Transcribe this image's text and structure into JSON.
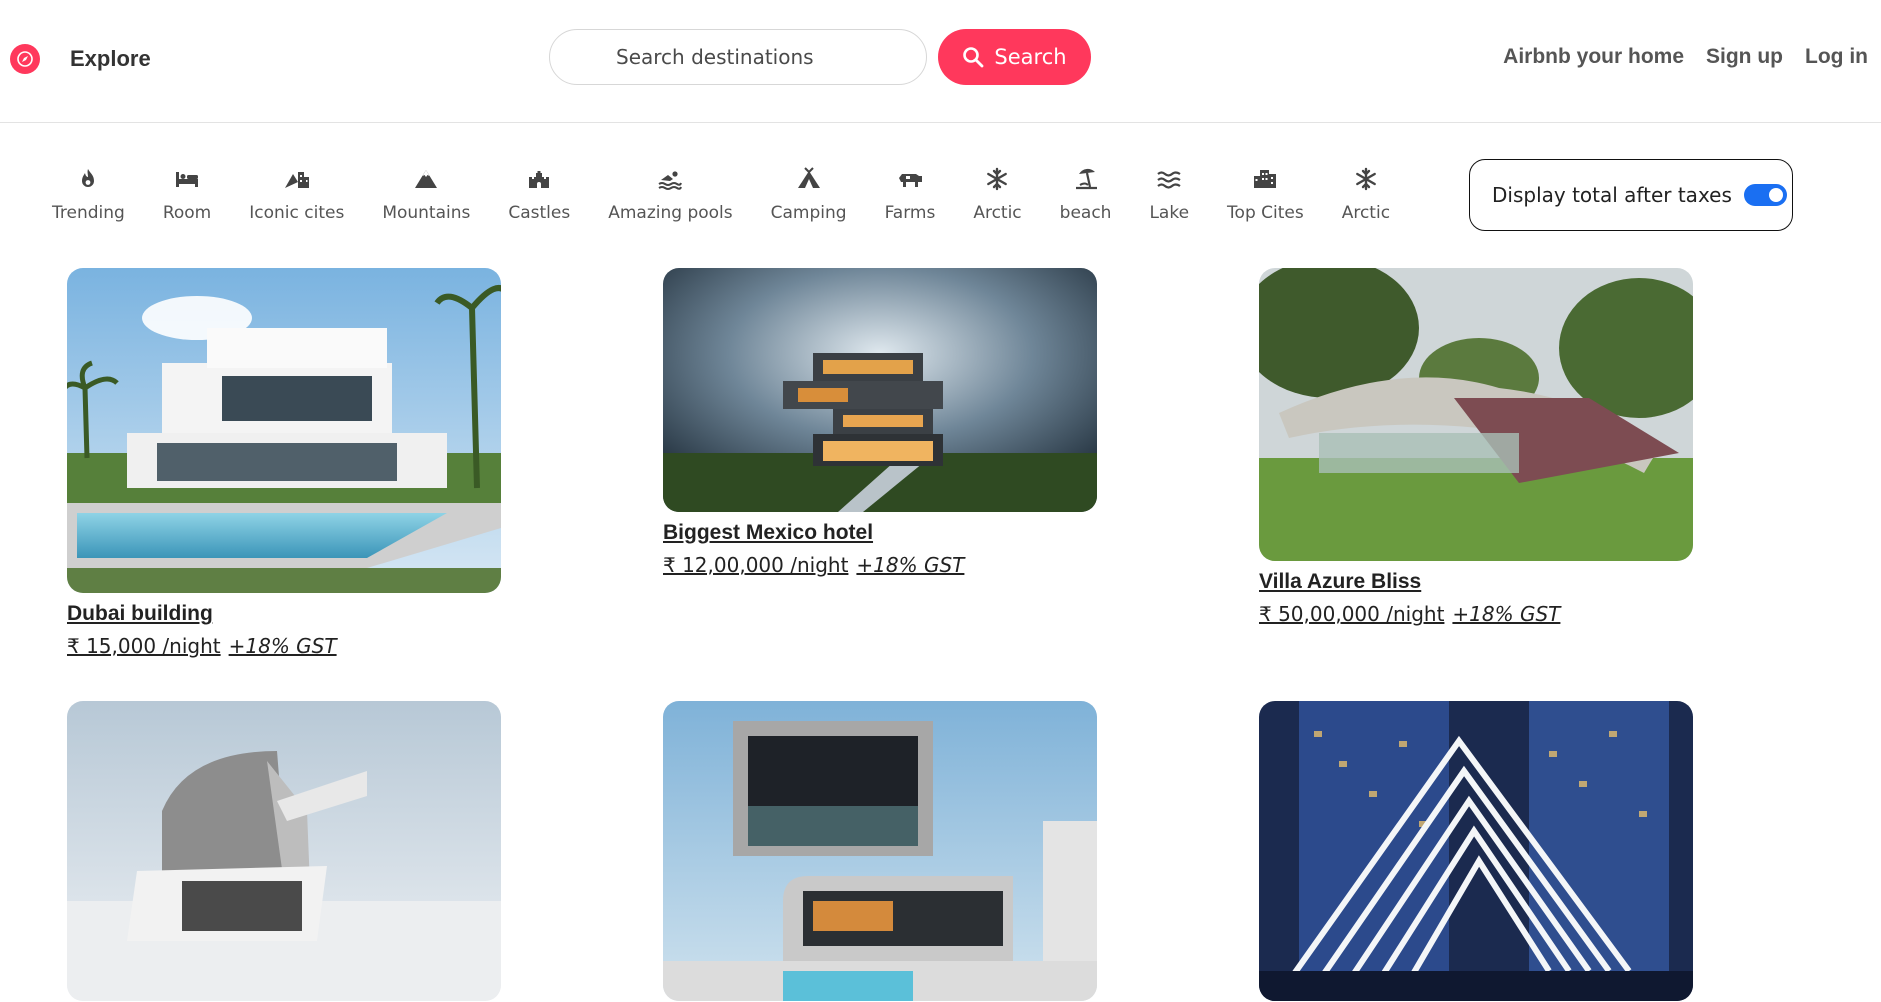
{
  "navbar": {
    "brand_label": "Explore",
    "brand_icon": "compass-icon",
    "search_placeholder": "Search destinations",
    "search_button_label": "Search",
    "links": [
      "Airbnb your home",
      "Sign up",
      "Log in"
    ]
  },
  "categories": [
    {
      "label": "Trending",
      "icon": "fire-icon"
    },
    {
      "label": "Room",
      "icon": "bed-icon"
    },
    {
      "label": "Iconic cites",
      "icon": "mountain-city-icon"
    },
    {
      "label": "Mountains",
      "icon": "mountain-icon"
    },
    {
      "label": "Castles",
      "icon": "castle-icon"
    },
    {
      "label": "Amazing pools",
      "icon": "swimmer-icon"
    },
    {
      "label": "Camping",
      "icon": "campground-icon"
    },
    {
      "label": "Farms",
      "icon": "cow-icon"
    },
    {
      "label": "Arctic",
      "icon": "snowflake-icon"
    },
    {
      "label": "beach",
      "icon": "umbrella-beach-icon"
    },
    {
      "label": "Lake",
      "icon": "water-icon"
    },
    {
      "label": "Top Cites",
      "icon": "city-icon"
    },
    {
      "label": "Arctic",
      "icon": "snowflake-icon"
    }
  ],
  "tax_toggle": {
    "label": "Display total after taxes",
    "enabled": true
  },
  "listings": [
    {
      "title": "Dubai building",
      "price": "₹ 15,000 /night",
      "tax": "+18% GST"
    },
    {
      "title": "Biggest Mexico hotel",
      "price": "₹ 12,00,000 /night",
      "tax": "+18% GST"
    },
    {
      "title": "Villa Azure Bliss",
      "price": "₹ 50,00,000 /night",
      "tax": "+18% GST"
    },
    {
      "title": "",
      "price": "",
      "tax": ""
    },
    {
      "title": "",
      "price": "",
      "tax": ""
    },
    {
      "title": "",
      "price": "",
      "tax": ""
    }
  ],
  "colors": {
    "brand": "#ff385c",
    "toggle": "#1a6ff2"
  }
}
